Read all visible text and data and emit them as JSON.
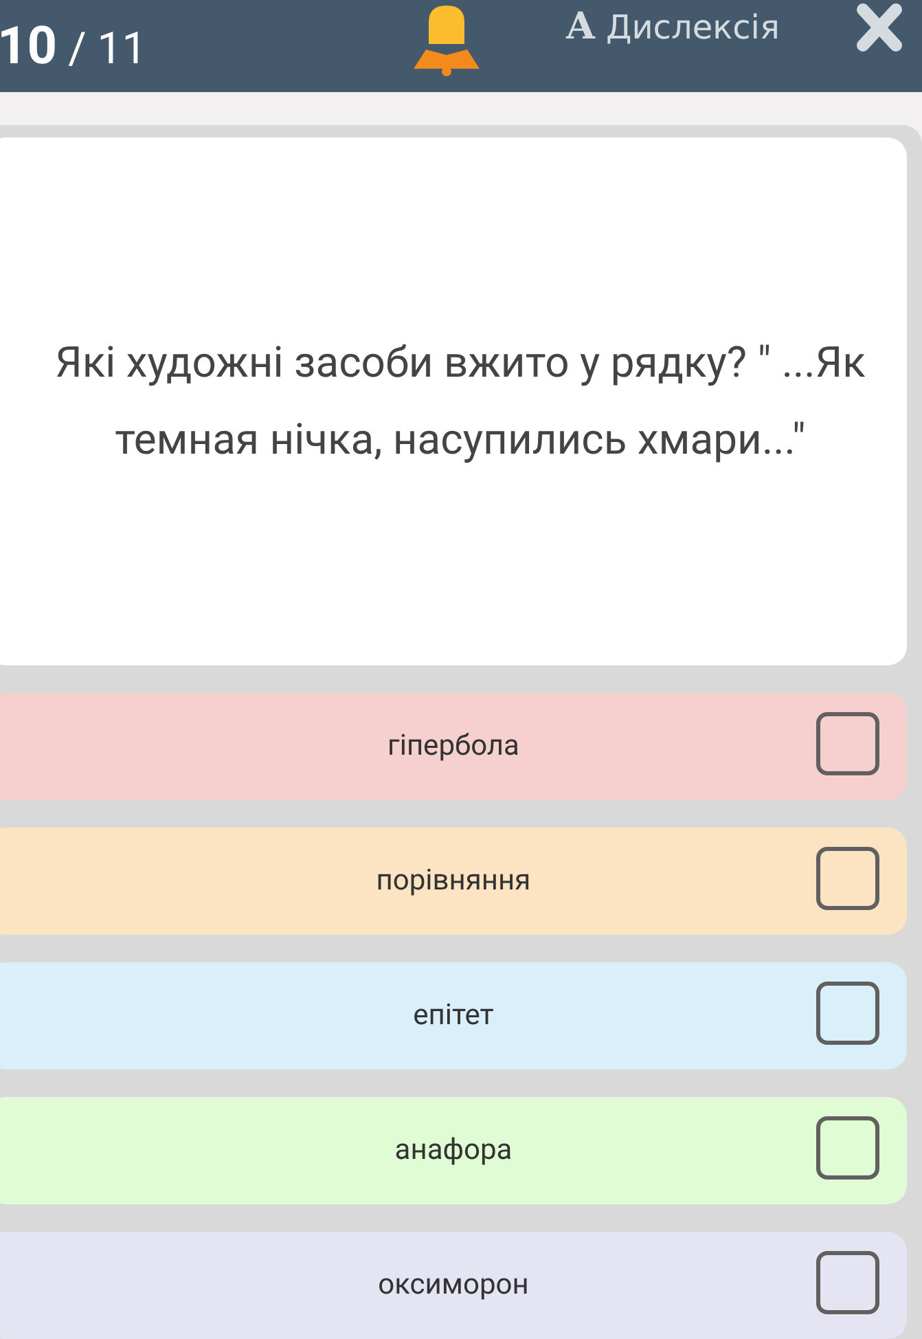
{
  "header": {
    "current": "10",
    "total": "/ 11",
    "dyslexia_button": "Дислексія",
    "dyslexia_glyph": "A"
  },
  "question": "Які художні засоби вжито у рядку? \" ...Як темная нічка, насупились хмари...\"",
  "options": [
    {
      "label": "гіпербола",
      "checked": false,
      "color": "#f6cfcf"
    },
    {
      "label": "порівняння",
      "checked": false,
      "color": "#fce3c1"
    },
    {
      "label": "епітет",
      "checked": false,
      "color": "#d9f0fb"
    },
    {
      "label": "анафора",
      "checked": false,
      "color": "#e0fcd5"
    },
    {
      "label": "оксиморон",
      "checked": false,
      "color": "#e4e4f2"
    }
  ]
}
